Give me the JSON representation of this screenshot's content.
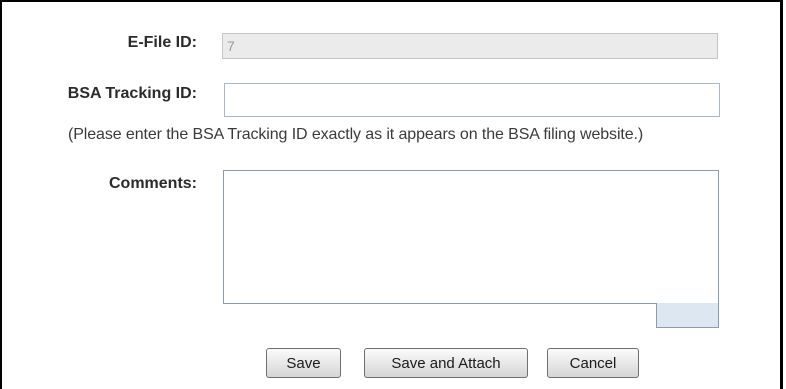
{
  "form": {
    "efile": {
      "label": "E-File ID:",
      "value": "7"
    },
    "bsa": {
      "label": "BSA Tracking ID:",
      "value": "",
      "hint": "(Please enter the BSA Tracking ID exactly as it appears on the BSA filing website.)"
    },
    "comments": {
      "label": "Comments:",
      "value": ""
    }
  },
  "buttons": {
    "save": "Save",
    "save_and_attach": "Save and Attach",
    "cancel": "Cancel"
  },
  "colors": {
    "readonly_background": "#ebebeb",
    "resize_tab": "#dde7f2",
    "frame_border": "#000000"
  }
}
